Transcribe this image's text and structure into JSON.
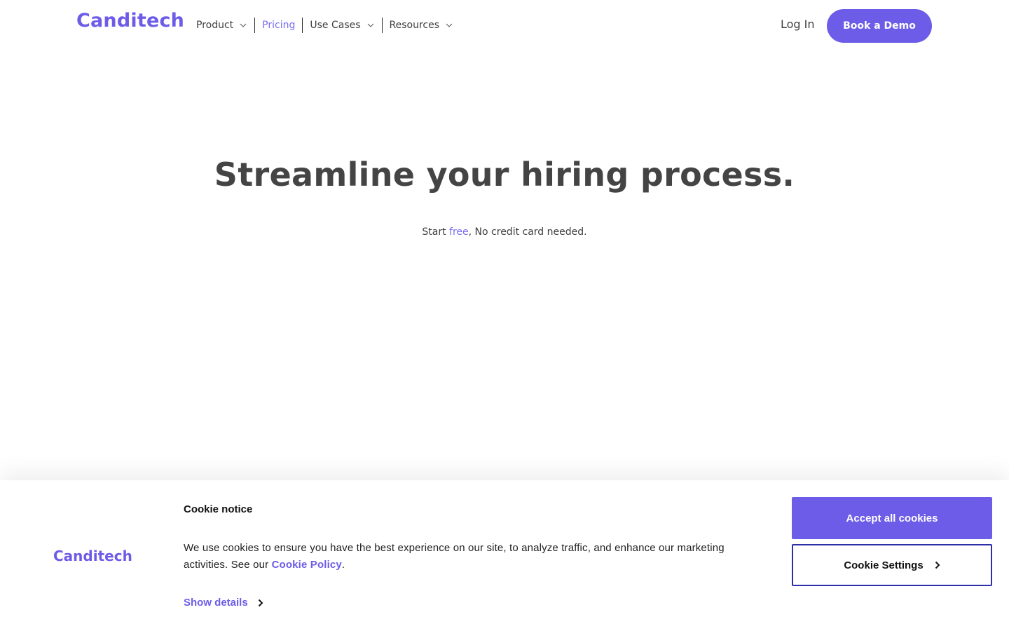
{
  "header": {
    "logo": "Canditech",
    "nav": [
      {
        "label": "Product",
        "has_dropdown": true,
        "active": false
      },
      {
        "label": "Pricing",
        "has_dropdown": false,
        "active": true
      },
      {
        "label": "Use Cases",
        "has_dropdown": true,
        "active": false
      },
      {
        "label": "Resources",
        "has_dropdown": true,
        "active": false
      }
    ],
    "login_label": "Log In",
    "demo_label": "Book a Demo"
  },
  "hero": {
    "title": "Streamline your hiring process.",
    "sub_prefix": "Start ",
    "sub_free": "free",
    "sub_suffix": ", No credit card needed."
  },
  "cookie_banner": {
    "logo": "Canditech",
    "title": "Cookie notice",
    "text": "We use cookies to ensure you have the best experience on our site, to analyze traffic, and enhance our marketing activities. See our ",
    "policy_link": "Cookie Policy",
    "text_end": ".",
    "show_details": "Show details",
    "accept_label": "Accept all cookies",
    "settings_label": "Cookie Settings"
  },
  "colors": {
    "brand": "#6c5ce7",
    "active_nav": "#7a6cf0",
    "heading": "#444444",
    "settings_border": "#2d2fa8"
  },
  "icons": {
    "nav_dropdown": "chevron-down-icon",
    "show_details": "chevron-right-icon",
    "settings": "chevron-right-icon"
  }
}
